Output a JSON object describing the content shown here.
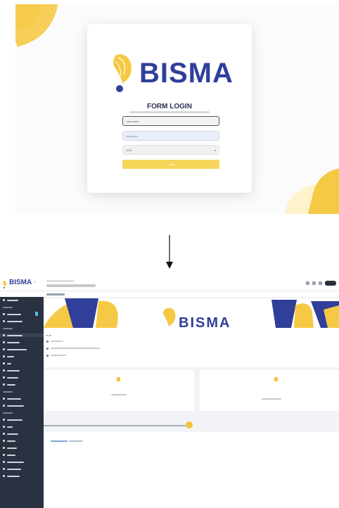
{
  "login": {
    "brand_name": "BISMA",
    "form_title": "FORM LOGIN",
    "username_placeholder": "Username",
    "password_value": "••••••••••••",
    "year_value": "2021",
    "login_button": "Login"
  },
  "dashboard": {
    "brand_name": "BISMA",
    "banner_name": "BISMA"
  },
  "colors": {
    "brand_blue": "#2f3f9a",
    "brand_yellow": "#f6c945",
    "sidebar_bg": "#2a3140"
  },
  "icons": {
    "logo": "bisma-logo-icon",
    "arrow": "arrow-down-icon",
    "select": "chevron-down-icon"
  }
}
